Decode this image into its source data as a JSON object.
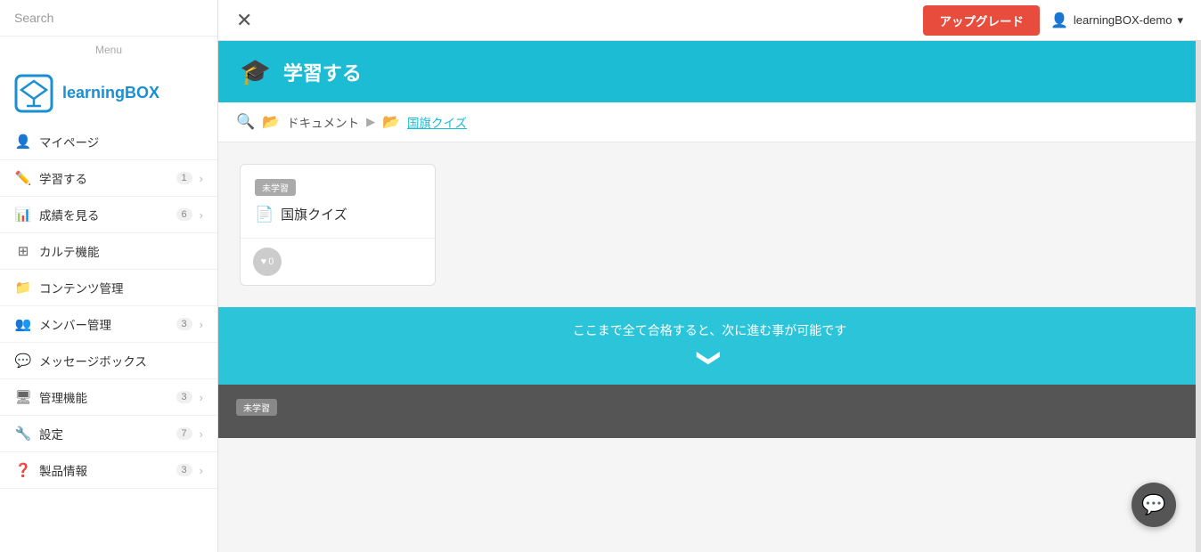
{
  "sidebar": {
    "search_placeholder": "Search",
    "menu_label": "Menu",
    "logo_text_part1": "learning",
    "logo_text_part2": "BOX",
    "nav_items": [
      {
        "id": "mypage",
        "label": "マイページ",
        "icon": "person",
        "badge": "",
        "has_arrow": false
      },
      {
        "id": "learn",
        "label": "学習する",
        "icon": "pencil",
        "badge": "1",
        "has_arrow": true
      },
      {
        "id": "results",
        "label": "成績を見る",
        "icon": "chart",
        "badge": "6",
        "has_arrow": true
      },
      {
        "id": "karute",
        "label": "カルテ機能",
        "icon": "grid",
        "badge": "",
        "has_arrow": false
      },
      {
        "id": "contents",
        "label": "コンテンツ管理",
        "icon": "folder",
        "badge": "",
        "has_arrow": false
      },
      {
        "id": "members",
        "label": "メンバー管理",
        "icon": "people",
        "badge": "3",
        "has_arrow": true
      },
      {
        "id": "messages",
        "label": "メッセージボックス",
        "icon": "chat",
        "badge": "",
        "has_arrow": false
      },
      {
        "id": "admin",
        "label": "管理機能",
        "icon": "monitor",
        "badge": "3",
        "has_arrow": true
      },
      {
        "id": "settings",
        "label": "設定",
        "icon": "wrench",
        "badge": "7",
        "has_arrow": true
      },
      {
        "id": "products",
        "label": "製品情報",
        "icon": "question",
        "badge": "3",
        "has_arrow": true
      }
    ]
  },
  "topbar": {
    "close_title": "×",
    "upgrade_label": "アップグレード",
    "user_name": "learningBOX-demo",
    "user_dropdown": "▾"
  },
  "page_header": {
    "icon": "🎓",
    "title": "学習する"
  },
  "breadcrumb": {
    "folder1_label": "ドキュメント",
    "arrow": "▶",
    "folder2_label": "国旗クイズ"
  },
  "card": {
    "status_badge": "未学習",
    "title": "国旗クイズ",
    "heart_count": "0"
  },
  "progress": {
    "message": "ここまで全て合格すると、次に進む事が可能です",
    "chevron": "❯"
  },
  "dark_section": {
    "badge_label": "未学習"
  },
  "chat": {
    "icon": "💬"
  }
}
